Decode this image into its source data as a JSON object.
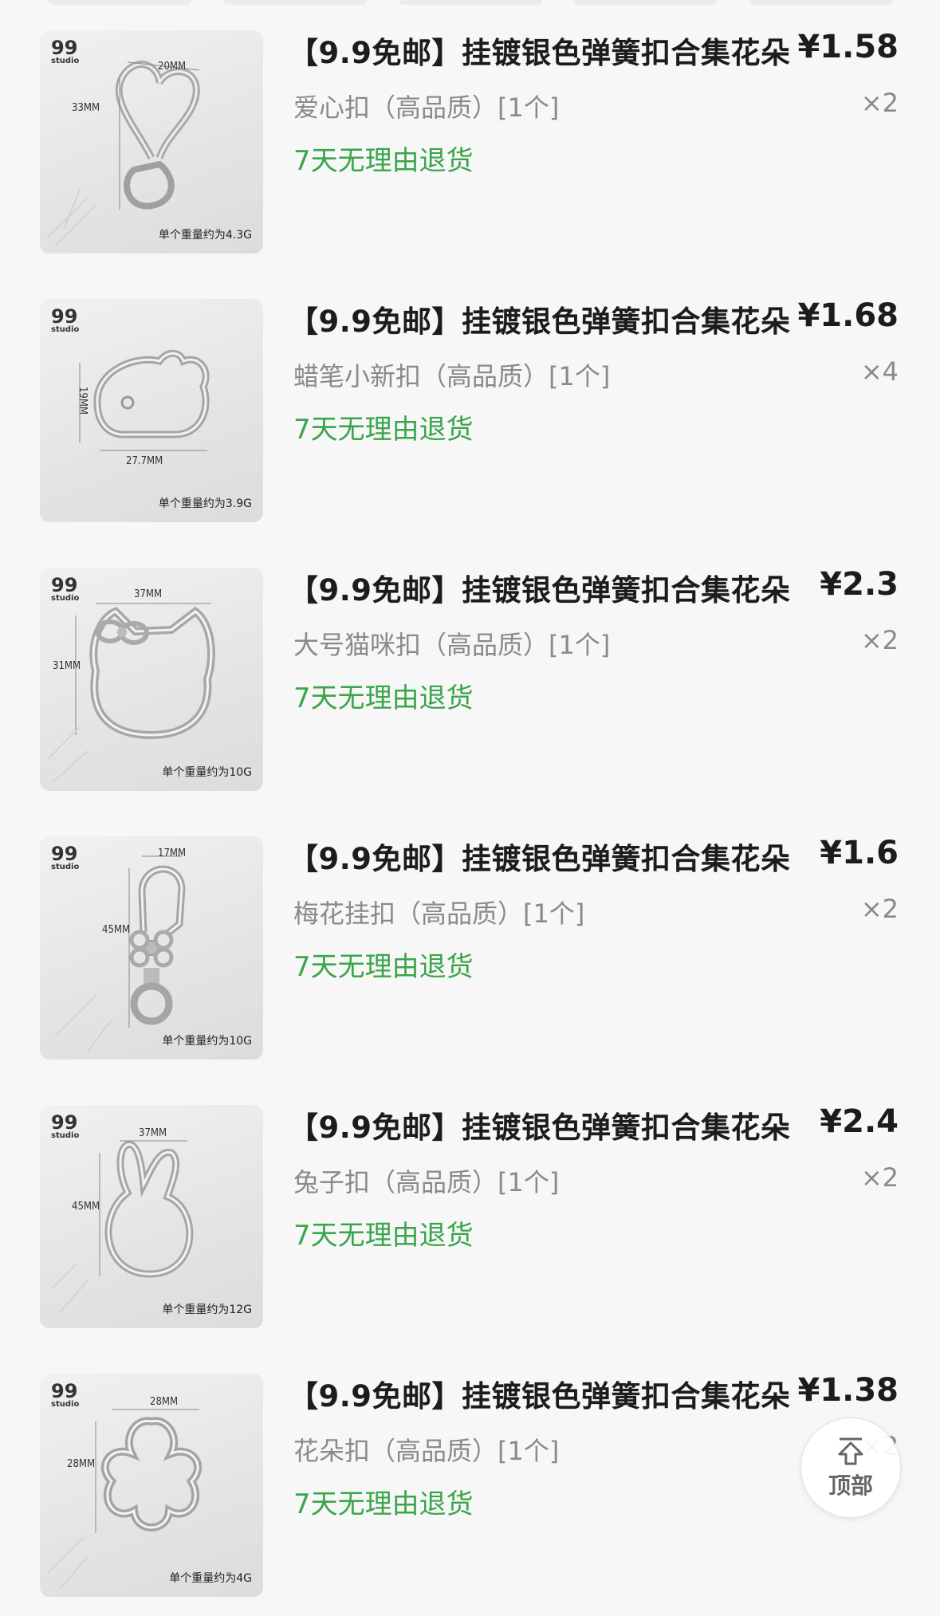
{
  "items": [
    {
      "title": "【9.9免邮】挂镀银色弹簧扣合集花朵",
      "price": "¥1.58",
      "variant": "爱心扣（高品质）[1个]",
      "qty": "×2",
      "returns": "7天无理由退货",
      "thumb": {
        "logo": "99",
        "logo_sub": "studio",
        "dim_a": "20MM",
        "dim_b": "33MM",
        "weight": "单个重量约为4.3G",
        "shape": "heart"
      }
    },
    {
      "title": "【9.9免邮】挂镀银色弹簧扣合集花朵",
      "price": "¥1.68",
      "variant": "蜡笔小新扣（高品质）[1个]",
      "qty": "×4",
      "returns": "7天无理由退货",
      "thumb": {
        "logo": "99",
        "logo_sub": "studio",
        "dim_a": "19MM",
        "dim_b": "27.7MM",
        "weight": "单个重量约为3.9G",
        "shape": "shinchan"
      }
    },
    {
      "title": "【9.9免邮】挂镀银色弹簧扣合集花朵",
      "price": "¥2.3",
      "variant": "大号猫咪扣（高品质）[1个]",
      "qty": "×2",
      "returns": "7天无理由退货",
      "thumb": {
        "logo": "99",
        "logo_sub": "studio",
        "dim_a": "37MM",
        "dim_b": "31MM",
        "weight": "单个重量约为10G",
        "shape": "cat"
      }
    },
    {
      "title": "【9.9免邮】挂镀银色弹簧扣合集花朵",
      "price": "¥1.6",
      "variant": "梅花挂扣（高品质）[1个]",
      "qty": "×2",
      "returns": "7天无理由退货",
      "thumb": {
        "logo": "99",
        "logo_sub": "studio",
        "dim_a": "17MM",
        "dim_b": "45MM",
        "weight": "单个重量约为10G",
        "shape": "hook"
      }
    },
    {
      "title": "【9.9免邮】挂镀银色弹簧扣合集花朵",
      "price": "¥2.4",
      "variant": "兔子扣（高品质）[1个]",
      "qty": "×2",
      "returns": "7天无理由退货",
      "thumb": {
        "logo": "99",
        "logo_sub": "studio",
        "dim_a": "37MM",
        "dim_b": "45MM",
        "weight": "单个重量约为12G",
        "shape": "rabbit"
      }
    },
    {
      "title": "【9.9免邮】挂镀银色弹簧扣合集花朵",
      "price": "¥1.38",
      "variant": "花朵扣（高品质）[1个]",
      "qty": "×2",
      "returns": "7天无理由退货",
      "thumb": {
        "logo": "99",
        "logo_sub": "studio",
        "dim_a": "28MM",
        "dim_b": "28MM",
        "weight": "单个重量约为4G",
        "shape": "flower"
      }
    }
  ],
  "back_to_top": {
    "label": "顶部",
    "icon": "arrow-up-icon"
  },
  "colors": {
    "returns_green": "#3aa54a",
    "text_dark": "#1c1c1c",
    "text_gray": "#8a8a8a"
  }
}
